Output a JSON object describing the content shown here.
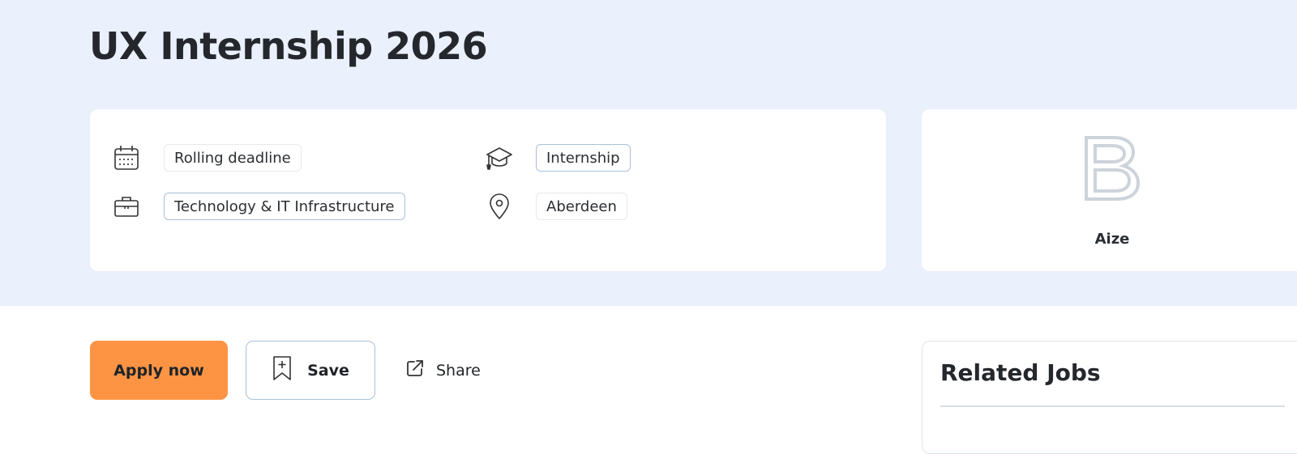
{
  "job": {
    "title": "UX Internship 2026"
  },
  "details": {
    "deadline": {
      "icon": "calendar-icon",
      "label": "Rolling deadline"
    },
    "type": {
      "icon": "graduation-cap-icon",
      "label": "Internship"
    },
    "sector": {
      "icon": "briefcase-icon",
      "label": "Technology & IT Infrastructure"
    },
    "location": {
      "icon": "map-pin-icon",
      "label": "Aberdeen"
    }
  },
  "company": {
    "logo_icon": "company-logo-b",
    "name": "Aize"
  },
  "actions": {
    "apply_label": "Apply now",
    "save_label": "Save",
    "share_label": "Share"
  },
  "related": {
    "title": "Related Jobs"
  },
  "colors": {
    "hero_background": "#eaf0fc",
    "apply_button": "#fd9444",
    "chip_border_accent": "#a9c0d8"
  }
}
